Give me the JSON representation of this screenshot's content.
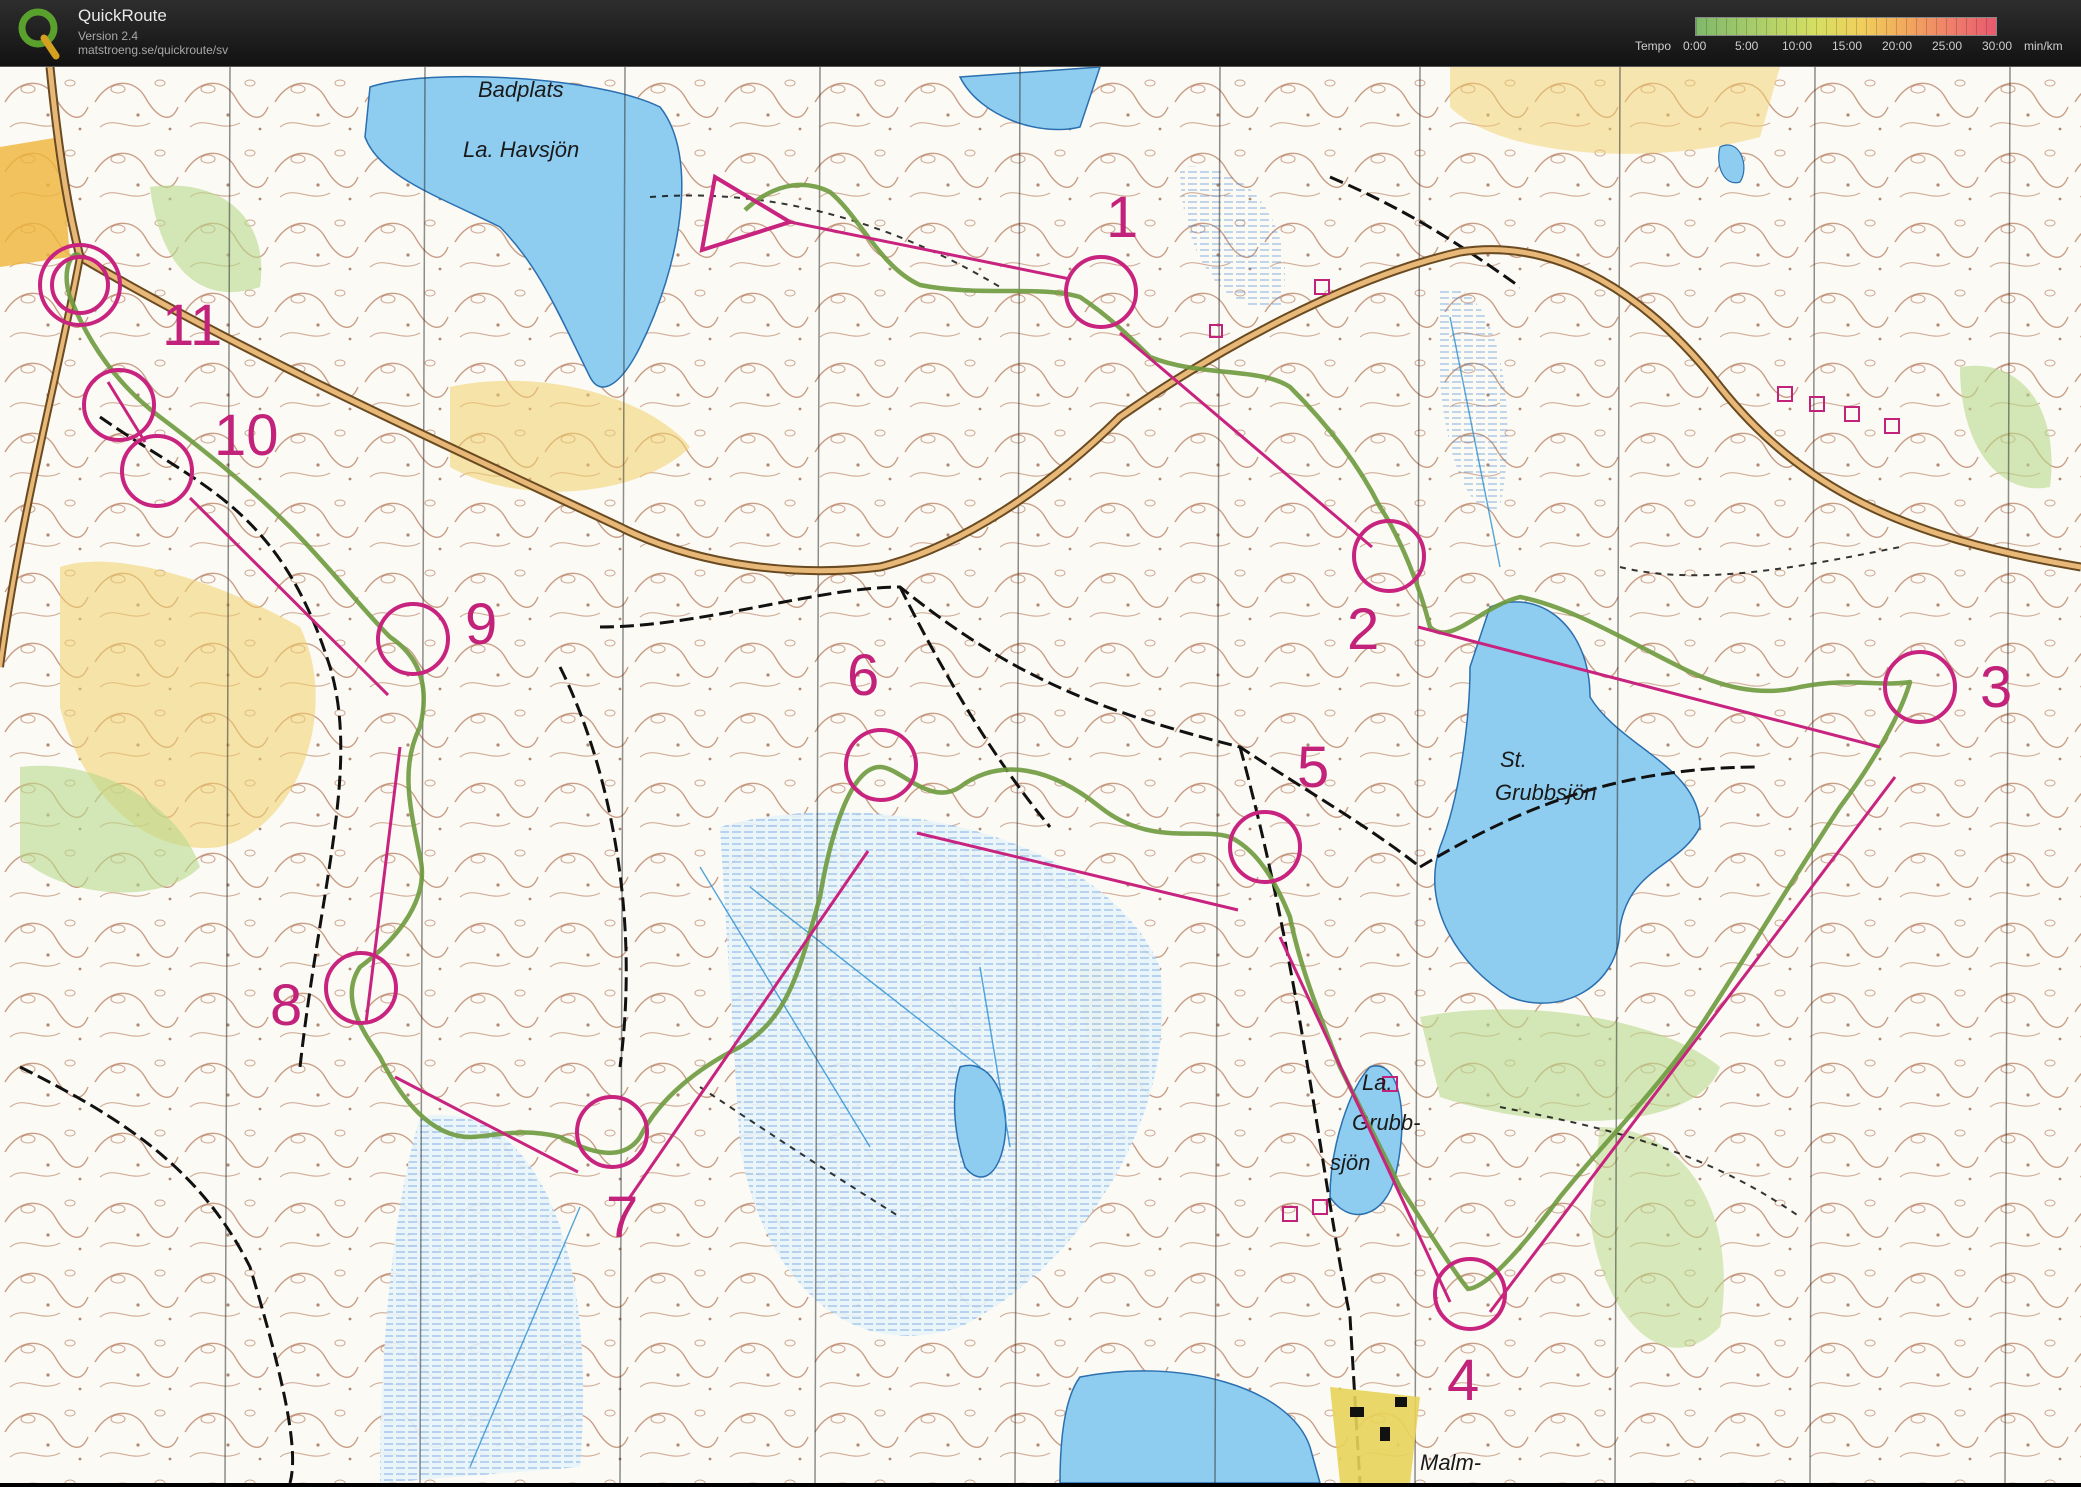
{
  "app": {
    "title": "QuickRoute",
    "version": "Version 2.4",
    "url": "matstroeng.se/quickroute/sv"
  },
  "tempo_legend": {
    "label": "Tempo",
    "ticks": [
      "0:00",
      "5:00",
      "10:00",
      "15:00",
      "20:00",
      "25:00",
      "30:00"
    ],
    "unit": "min/km"
  },
  "map_labels": {
    "badplats": "Badplats",
    "la_havsjon": "La. Havsjön",
    "st": "St.",
    "grubbsjon": "Grubbsjön",
    "la": "La.",
    "grubb": "Grubb-",
    "sjon": "sjön",
    "malm": "Malm-"
  },
  "controls": [
    "1",
    "2",
    "3",
    "4",
    "5",
    "6",
    "7",
    "8",
    "9",
    "10",
    "11"
  ],
  "colors": {
    "course": "#c8237f",
    "route": "#6e9a3e",
    "water": "#8ecdf0",
    "contour": "#a0522d",
    "paper": "#fbfaf4",
    "road": "#d9a15a"
  }
}
